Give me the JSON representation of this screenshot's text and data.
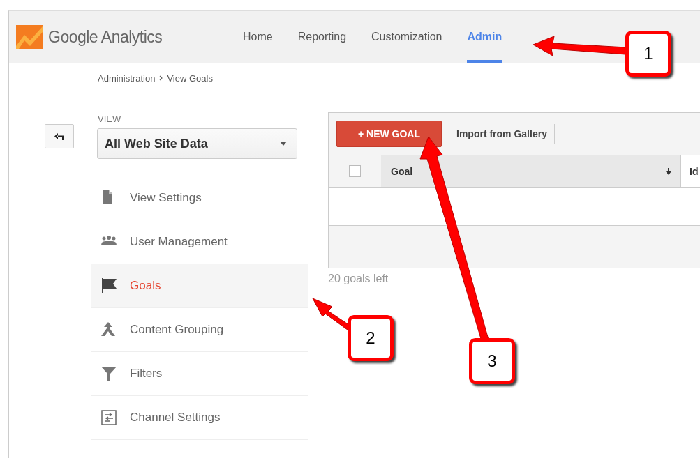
{
  "header": {
    "logo_text": "Google Analytics",
    "tabs": [
      {
        "label": "Home",
        "selected": false
      },
      {
        "label": "Reporting",
        "selected": false
      },
      {
        "label": "Customization",
        "selected": false
      },
      {
        "label": "Admin",
        "selected": true
      }
    ]
  },
  "breadcrumb": [
    "Administration",
    "View Goals"
  ],
  "sidebar": {
    "view_label": "VIEW",
    "view_select": "All Web Site Data",
    "items": [
      {
        "label": "View Settings",
        "kind": "page",
        "selected": false
      },
      {
        "label": "User Management",
        "kind": "users",
        "selected": false
      },
      {
        "label": "Goals",
        "kind": "flag",
        "selected": true
      },
      {
        "label": "Content Grouping",
        "kind": "merge",
        "selected": false
      },
      {
        "label": "Filters",
        "kind": "filter",
        "selected": false
      },
      {
        "label": "Channel Settings",
        "kind": "channels",
        "selected": false
      }
    ]
  },
  "content": {
    "new_button": "+ NEW GOAL",
    "import_link": "Import from Gallery",
    "select_all_checked": false,
    "columns": [
      "Goal",
      "Id"
    ],
    "goals_left": "20 goals left"
  },
  "annotations": [
    {
      "label": "1"
    },
    {
      "label": "2"
    },
    {
      "label": "3"
    }
  ]
}
